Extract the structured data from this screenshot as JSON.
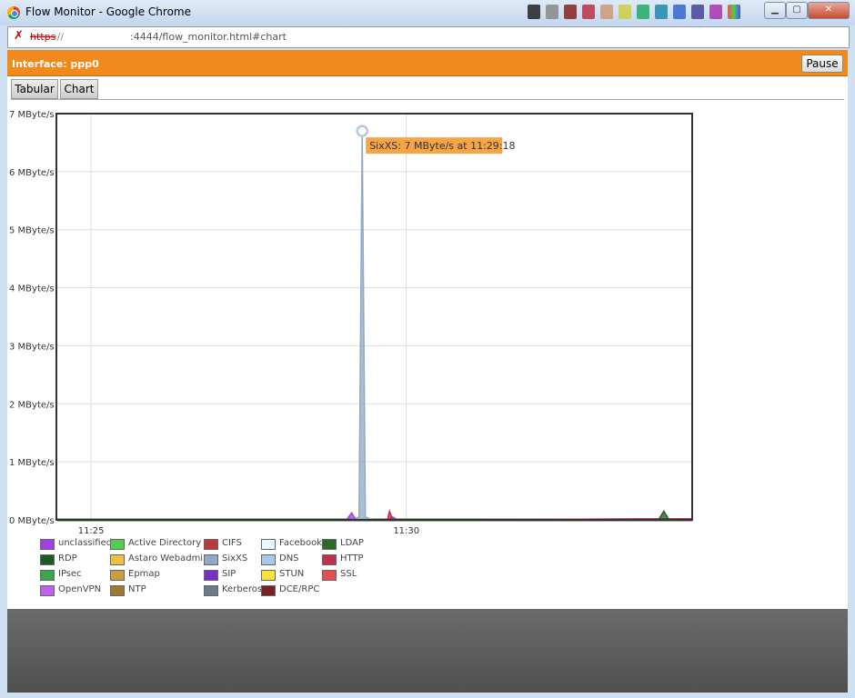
{
  "window": {
    "title": "Flow Monitor - Google Chrome",
    "minimize": "▁",
    "maximize": "▢",
    "close": "✕"
  },
  "address_bar": {
    "protocol": "https",
    "separator": "://",
    "url_path": ":4444/flow_monitor.html#chart"
  },
  "header": {
    "interface_label": "Interface: ppp0",
    "pause_label": "Pause"
  },
  "tabs": [
    {
      "label": "Tabular"
    },
    {
      "label": "Chart"
    }
  ],
  "tooltip": {
    "text": "SixXS: 7 MByte/s at 11:29:18"
  },
  "chart_data": {
    "type": "area",
    "title": "",
    "xlabel": "",
    "ylabel": "",
    "x_ticks": [
      "11:25",
      "11:30"
    ],
    "y_ticks": [
      "0 MByte/s",
      "1 MByte/s",
      "2 MByte/s",
      "3 MByte/s",
      "4 MByte/s",
      "5 MByte/s",
      "6 MByte/s",
      "7 MByte/s"
    ],
    "ylim": [
      0,
      7
    ],
    "x_range": [
      "11:24:27",
      "11:34:32"
    ],
    "grid": true,
    "legend_position": "bottom-left",
    "series": [
      {
        "name": "SixXS",
        "color": "#8fa9c6",
        "points": [
          [
            "11:29:08",
            0
          ],
          [
            "11:29:15",
            0.05
          ],
          [
            "11:29:18",
            6.7
          ],
          [
            "11:29:21",
            0.05
          ],
          [
            "11:29:28",
            0
          ]
        ]
      },
      {
        "name": "unclassified",
        "color": "#a040e0",
        "points": [
          [
            "11:29:03",
            0
          ],
          [
            "11:29:08",
            0.12
          ],
          [
            "11:29:12",
            0
          ],
          [
            "11:29:42",
            0
          ],
          [
            "11:29:47",
            0.05
          ],
          [
            "11:29:52",
            0
          ],
          [
            "11:34:32",
            0.02
          ]
        ]
      },
      {
        "name": "HTTP",
        "color": "#c0304a",
        "points": [
          [
            "11:29:42",
            0
          ],
          [
            "11:29:44",
            0.15
          ],
          [
            "11:29:47",
            0
          ],
          [
            "11:34:32",
            0.02
          ]
        ]
      },
      {
        "name": "RDP",
        "color": "#1f5a24",
        "points": [
          [
            "11:34:00",
            0
          ],
          [
            "11:34:05",
            0.15
          ],
          [
            "11:34:10",
            0
          ]
        ]
      }
    ],
    "legend": [
      {
        "name": "unclassified",
        "color": "#a040e0"
      },
      {
        "name": "RDP",
        "color": "#1f5a24"
      },
      {
        "name": "IPsec",
        "color": "#3aa84a"
      },
      {
        "name": "OpenVPN",
        "color": "#c060f0"
      },
      {
        "name": "Active Directory",
        "color": "#55cc55"
      },
      {
        "name": "Astaro Webadmin",
        "color": "#f0c040"
      },
      {
        "name": "Epmap",
        "color": "#c8a040"
      },
      {
        "name": "NTP",
        "color": "#a07830"
      },
      {
        "name": "CIFS",
        "color": "#b83a3a"
      },
      {
        "name": "SixXS",
        "color": "#8fa9c6"
      },
      {
        "name": "SIP",
        "color": "#7a30c0"
      },
      {
        "name": "Kerberos",
        "color": "#6a7a8a"
      },
      {
        "name": "Facebook",
        "color": "#e8f8ff"
      },
      {
        "name": "DNS",
        "color": "#a8c8e8"
      },
      {
        "name": "STUN",
        "color": "#f8e040"
      },
      {
        "name": "DCE/RPC",
        "color": "#7a2020"
      },
      {
        "name": "LDAP",
        "color": "#2a6a2a"
      },
      {
        "name": "HTTP",
        "color": "#c0304a"
      },
      {
        "name": "SSL",
        "color": "#e05050"
      }
    ]
  }
}
